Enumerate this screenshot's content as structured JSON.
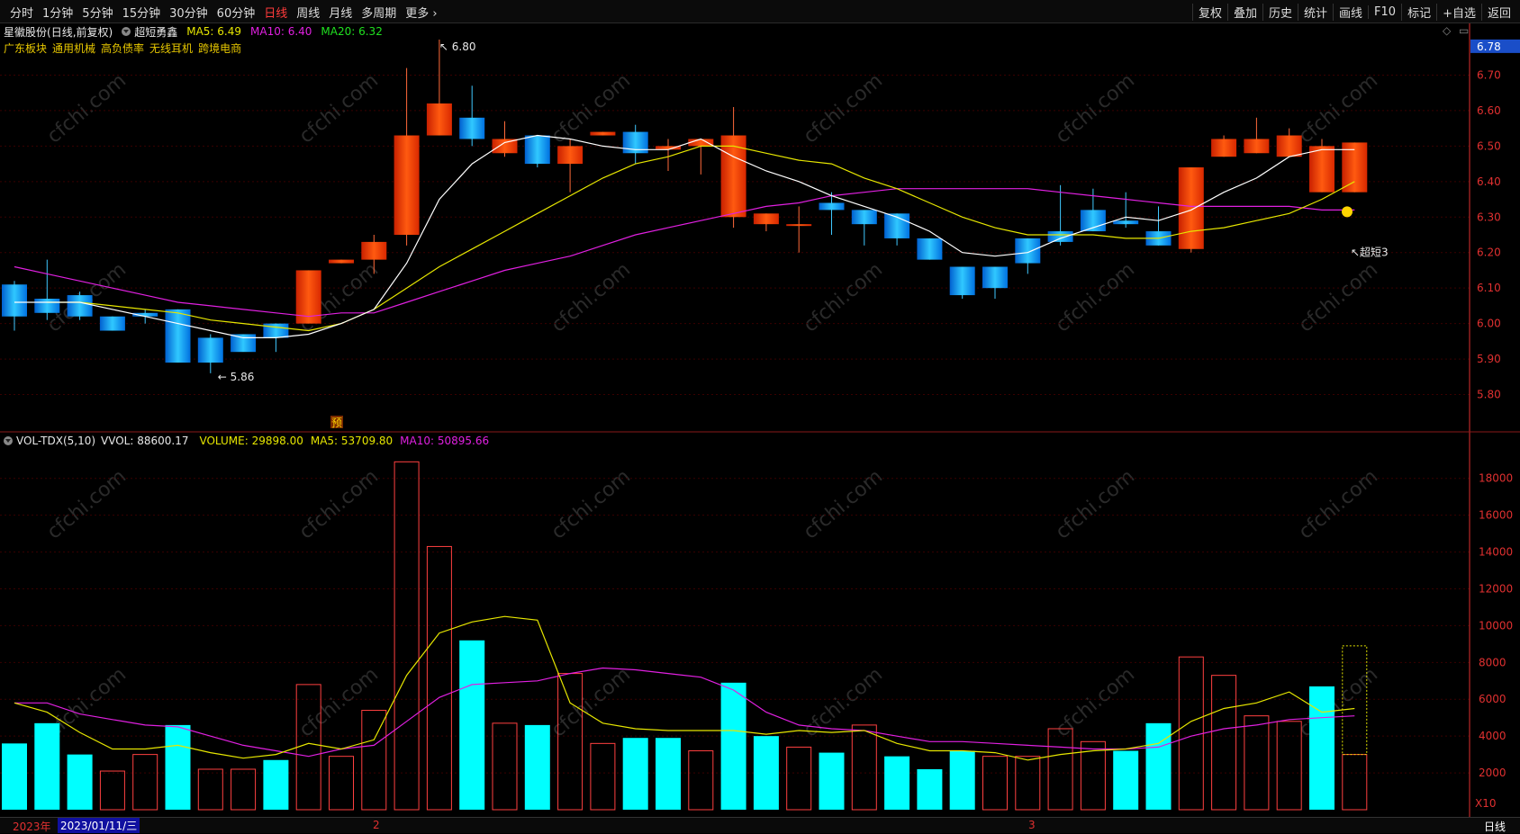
{
  "toolbar": {
    "periods": [
      "分时",
      "1分钟",
      "5分钟",
      "15分钟",
      "30分钟",
      "60分钟",
      "日线",
      "周线",
      "月线",
      "多周期",
      "更多 ›"
    ],
    "active_period": "日线",
    "right_buttons": [
      "复权",
      "叠加",
      "历史",
      "统计",
      "画线",
      "F10",
      "标记",
      "+自选",
      "返回"
    ]
  },
  "info": {
    "stock_name": "星徽股份",
    "period_note": "(日线,前复权)",
    "indicator": "超短勇鑫",
    "ma5": "MA5: 6.49",
    "ma10": "MA10: 6.40",
    "ma20": "MA20: 6.32"
  },
  "tags": [
    "广东板块",
    "通用机械",
    "高负债率",
    "无线耳机",
    "跨境电商"
  ],
  "annotations": {
    "high": "6.80",
    "low": "5.86",
    "signal": "超短3",
    "pre_marker": "预",
    "last_price": "6.78"
  },
  "volume_info": {
    "name": "VOL-TDX(5,10)",
    "vvol": "VVOL: 88600.17",
    "volume": "VOLUME: 29898.00",
    "ma5": "MA5: 53709.80",
    "ma10": "MA10: 50895.66",
    "unit": "X10"
  },
  "statusbar": {
    "year": "2023年",
    "date": "2023/01/11/三",
    "month2": "2",
    "month3": "3",
    "period_label": "日线"
  },
  "watermark": "cfchi.com",
  "colors": {
    "up": "#ff4a1a",
    "down": "#19b4ff",
    "vol_down": "#00ffff",
    "ma5": "#ffffff",
    "ma10": "#e6e600",
    "ma20": "#e020e0",
    "price_axis": "#e03030",
    "volume_axis": "#e03030"
  },
  "chart_data": [
    {
      "type": "candlestick",
      "ylim": [
        5.7,
        6.8
      ],
      "yticks": [
        5.8,
        5.9,
        6.0,
        6.1,
        6.2,
        6.3,
        6.4,
        6.5,
        6.6,
        6.7
      ],
      "ohlc": [
        [
          6.11,
          6.12,
          5.98,
          6.02
        ],
        [
          6.07,
          6.18,
          6.01,
          6.03
        ],
        [
          6.08,
          6.09,
          6.01,
          6.02
        ],
        [
          6.02,
          6.02,
          5.98,
          5.98
        ],
        [
          6.03,
          6.04,
          6.0,
          6.02
        ],
        [
          6.04,
          6.04,
          5.89,
          5.89
        ],
        [
          5.96,
          5.97,
          5.86,
          5.89
        ],
        [
          5.97,
          5.97,
          5.94,
          5.92
        ],
        [
          6.0,
          6.0,
          5.92,
          5.96
        ],
        [
          6.0,
          6.15,
          6.0,
          6.15
        ],
        [
          6.17,
          6.18,
          6.17,
          6.18
        ],
        [
          6.18,
          6.25,
          6.14,
          6.23
        ],
        [
          6.25,
          6.72,
          6.22,
          6.53
        ],
        [
          6.53,
          6.8,
          6.53,
          6.62
        ],
        [
          6.58,
          6.67,
          6.5,
          6.52
        ],
        [
          6.48,
          6.57,
          6.47,
          6.52
        ],
        [
          6.53,
          6.53,
          6.44,
          6.45
        ],
        [
          6.45,
          6.52,
          6.37,
          6.5
        ],
        [
          6.53,
          6.54,
          6.53,
          6.54
        ],
        [
          6.54,
          6.56,
          6.45,
          6.48
        ],
        [
          6.49,
          6.52,
          6.43,
          6.5
        ],
        [
          6.5,
          6.52,
          6.42,
          6.52
        ],
        [
          6.3,
          6.61,
          6.27,
          6.53
        ],
        [
          6.28,
          6.31,
          6.26,
          6.31
        ],
        [
          6.28,
          6.33,
          6.2,
          6.28
        ],
        [
          6.34,
          6.37,
          6.25,
          6.32
        ],
        [
          6.32,
          6.31,
          6.22,
          6.28
        ],
        [
          6.31,
          6.31,
          6.22,
          6.24
        ],
        [
          6.24,
          6.24,
          6.18,
          6.18
        ],
        [
          6.16,
          6.16,
          6.07,
          6.08
        ],
        [
          6.16,
          6.16,
          6.07,
          6.1
        ],
        [
          6.24,
          6.24,
          6.14,
          6.17
        ],
        [
          6.26,
          6.39,
          6.22,
          6.23
        ],
        [
          6.32,
          6.38,
          6.26,
          6.26
        ],
        [
          6.29,
          6.37,
          6.27,
          6.28
        ],
        [
          6.26,
          6.33,
          6.22,
          6.22
        ],
        [
          6.21,
          6.43,
          6.2,
          6.44
        ],
        [
          6.47,
          6.53,
          6.47,
          6.52
        ],
        [
          6.48,
          6.58,
          6.48,
          6.52
        ],
        [
          6.47,
          6.55,
          6.47,
          6.53
        ],
        [
          6.37,
          6.52,
          6.37,
          6.5
        ],
        [
          6.37,
          6.51,
          6.37,
          6.51
        ]
      ],
      "ma5": [
        6.06,
        6.06,
        6.06,
        6.04,
        6.02,
        6.0,
        5.98,
        5.96,
        5.96,
        5.97,
        6.0,
        6.04,
        6.17,
        6.35,
        6.45,
        6.51,
        6.53,
        6.52,
        6.5,
        6.49,
        6.49,
        6.52,
        6.47,
        6.43,
        6.4,
        6.36,
        6.33,
        6.3,
        6.26,
        6.2,
        6.19,
        6.2,
        6.24,
        6.27,
        6.3,
        6.29,
        6.32,
        6.37,
        6.41,
        6.47,
        6.49,
        6.49
      ],
      "ma10": [
        null,
        6.06,
        6.06,
        6.05,
        6.04,
        6.03,
        6.01,
        6.0,
        5.99,
        5.98,
        6.0,
        6.04,
        6.1,
        6.16,
        6.21,
        6.26,
        6.31,
        6.36,
        6.41,
        6.45,
        6.47,
        6.5,
        6.5,
        6.48,
        6.46,
        6.45,
        6.41,
        6.38,
        6.34,
        6.3,
        6.27,
        6.25,
        6.25,
        6.25,
        6.24,
        6.24,
        6.26,
        6.27,
        6.29,
        6.31,
        6.35,
        6.4
      ],
      "ma20": [
        6.16,
        6.14,
        6.12,
        6.1,
        6.08,
        6.06,
        6.05,
        6.04,
        6.03,
        6.02,
        6.03,
        6.03,
        6.06,
        6.09,
        6.12,
        6.15,
        6.17,
        6.19,
        6.22,
        6.25,
        6.27,
        6.29,
        6.31,
        6.33,
        6.34,
        6.36,
        6.37,
        6.38,
        6.38,
        6.38,
        6.38,
        6.38,
        6.37,
        6.36,
        6.35,
        6.34,
        6.33,
        6.33,
        6.33,
        6.33,
        6.32,
        6.32
      ]
    },
    {
      "type": "bar",
      "unit": "X10",
      "ylim": [
        0,
        19600
      ],
      "yticks": [
        2000,
        4000,
        6000,
        8000,
        10000,
        12000,
        14000,
        16000,
        18000
      ],
      "values": [
        3600,
        4700,
        3000,
        2100,
        3000,
        4600,
        2200,
        2200,
        2700,
        6800,
        2900,
        5400,
        18900,
        14300,
        9200,
        4700,
        4600,
        7400,
        3600,
        3900,
        3900,
        3200,
        6900,
        4000,
        3400,
        3100,
        4600,
        2900,
        2200,
        3200,
        2900,
        2900,
        4400,
        3700,
        3200,
        4700,
        8300,
        7300,
        5100,
        4800,
        6700,
        3000
      ],
      "up": [
        false,
        false,
        false,
        true,
        true,
        false,
        true,
        true,
        false,
        true,
        true,
        true,
        true,
        true,
        false,
        true,
        false,
        true,
        true,
        false,
        false,
        true,
        false,
        false,
        true,
        false,
        true,
        false,
        false,
        false,
        true,
        true,
        true,
        true,
        false,
        false,
        true,
        true,
        true,
        true,
        false,
        true
      ],
      "ma5": [
        5800,
        5300,
        4200,
        3300,
        3300,
        3500,
        3100,
        2800,
        3000,
        3600,
        3300,
        3800,
        7300,
        9600,
        10200,
        10500,
        10300,
        5800,
        4700,
        4400,
        4300,
        4300,
        4300,
        4100,
        4300,
        4200,
        4300,
        3600,
        3200,
        3200,
        3100,
        2700,
        3000,
        3200,
        3300,
        3600,
        4800,
        5500,
        5800,
        6400,
        5300,
        5500
      ],
      "ma10": [
        5800,
        5800,
        5200,
        4900,
        4600,
        4500,
        4000,
        3500,
        3200,
        2900,
        3300,
        3500,
        4800,
        6100,
        6800,
        6900,
        7000,
        7400,
        7700,
        7600,
        7400,
        7200,
        6500,
        5300,
        4600,
        4400,
        4300,
        4000,
        3700,
        3700,
        3600,
        3500,
        3400,
        3300,
        3300,
        3400,
        4000,
        4400,
        4600,
        4900,
        5000,
        5100
      ]
    }
  ]
}
